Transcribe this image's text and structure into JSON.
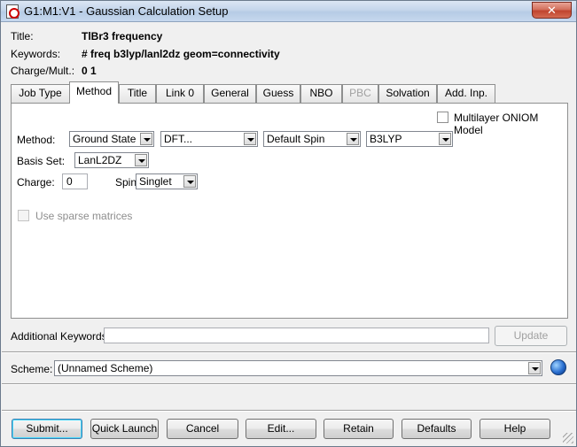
{
  "window": {
    "title": "G1:M1:V1 - Gaussian Calculation Setup",
    "close_glyph": "✕"
  },
  "info": {
    "title_label": "Title:",
    "title_value": "TlBr3 frequency",
    "keywords_label": "Keywords:",
    "keywords_value": "# freq b3lyp/lanl2dz geom=connectivity",
    "charge_label": "Charge/Mult.:",
    "charge_value": "0 1"
  },
  "tabs": [
    {
      "label": "Job Type",
      "state": "normal"
    },
    {
      "label": "Method",
      "state": "active"
    },
    {
      "label": "Title",
      "state": "normal"
    },
    {
      "label": "Link 0",
      "state": "normal"
    },
    {
      "label": "General",
      "state": "normal"
    },
    {
      "label": "Guess",
      "state": "normal"
    },
    {
      "label": "NBO",
      "state": "normal"
    },
    {
      "label": "PBC",
      "state": "disabled"
    },
    {
      "label": "Solvation",
      "state": "normal"
    },
    {
      "label": "Add. Inp.",
      "state": "normal"
    }
  ],
  "method_panel": {
    "oniom_label": "Multilayer ONIOM Model",
    "oniom_checked": false,
    "method_label": "Method:",
    "method_state": "Ground State",
    "method_type": "DFT...",
    "spin_type": "Default Spin",
    "functional": "B3LYP",
    "basis_label": "Basis Set:",
    "basis_value": "LanL2DZ",
    "charge_label": "Charge:",
    "charge_value": "0",
    "spin_label": "Spin:",
    "spin_value": "Singlet",
    "sparse_label": "Use sparse matrices",
    "sparse_checked": false,
    "sparse_enabled": false
  },
  "additional": {
    "label": "Additional Keywords:",
    "value": "",
    "update_label": "Update",
    "update_enabled": false
  },
  "scheme": {
    "label": "Scheme:",
    "value": "(Unnamed Scheme)",
    "icon": "globe-icon"
  },
  "buttons": {
    "submit": "Submit...",
    "quick_launch": "Quick Launch",
    "cancel": "Cancel",
    "edit": "Edit...",
    "retain": "Retain",
    "defaults": "Defaults",
    "help": "Help"
  }
}
